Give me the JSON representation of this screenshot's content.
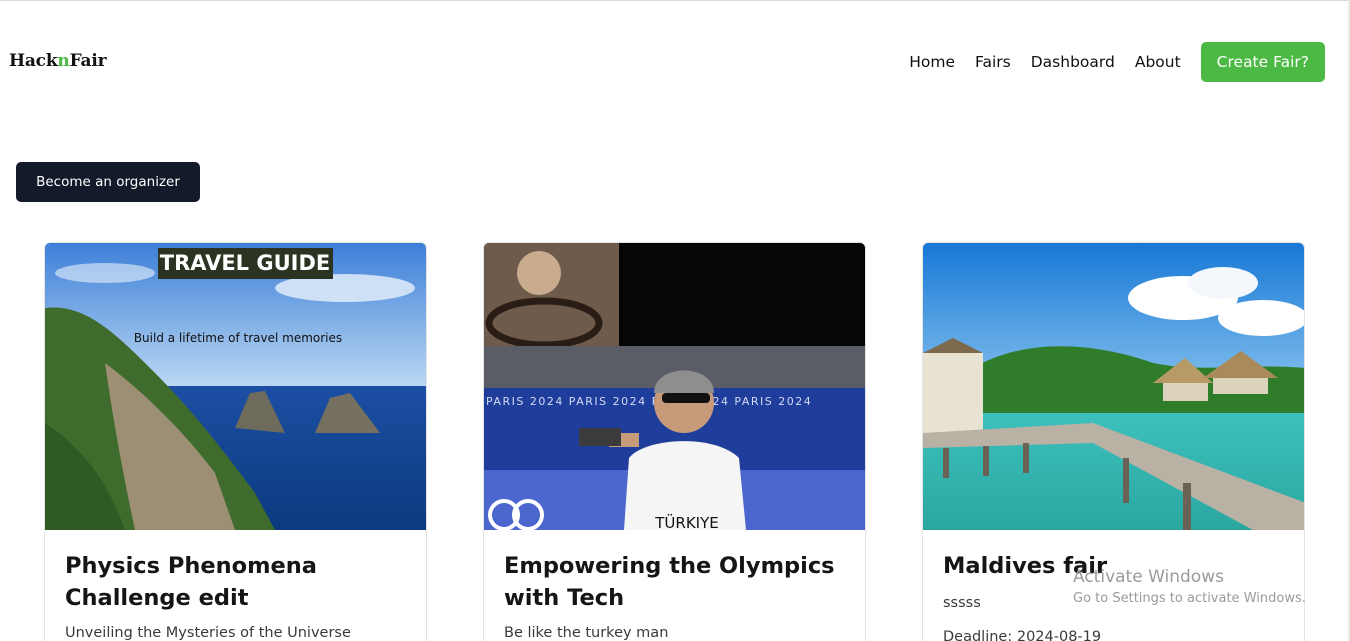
{
  "brand": {
    "prefix": "Hack",
    "accent": "n",
    "suffix": "Fair",
    "accent_color": "#4cb944"
  },
  "nav": {
    "items": [
      "Home",
      "Fairs",
      "Dashboard",
      "About"
    ],
    "cta_label": "Create Fair?"
  },
  "organizer_button": "Become an organizer",
  "cards": [
    {
      "image_heading": "TRAVEL GUIDE",
      "image_caption": "Build a lifetime of travel memories",
      "title": "Physics Phenomena Challenge edit",
      "description": "Unveiling the Mysteries of the Universe"
    },
    {
      "image_banner_text": "PARIS 2024   PARIS 2024   PARIS 2024   PARIS 2024",
      "image_shirt_text": "TÜRKIYE",
      "title": "Empowering the Olympics with Tech",
      "description": "Be like the turkey man"
    },
    {
      "title": "Maldives fair",
      "description": "sssss",
      "deadline": "Deadline: 2024-08-19"
    }
  ],
  "os_watermark": {
    "title": "Activate Windows",
    "subtitle": "Go to Settings to activate Windows."
  },
  "colors": {
    "primary_green": "#4cb944",
    "dark_button": "#131a2a"
  }
}
